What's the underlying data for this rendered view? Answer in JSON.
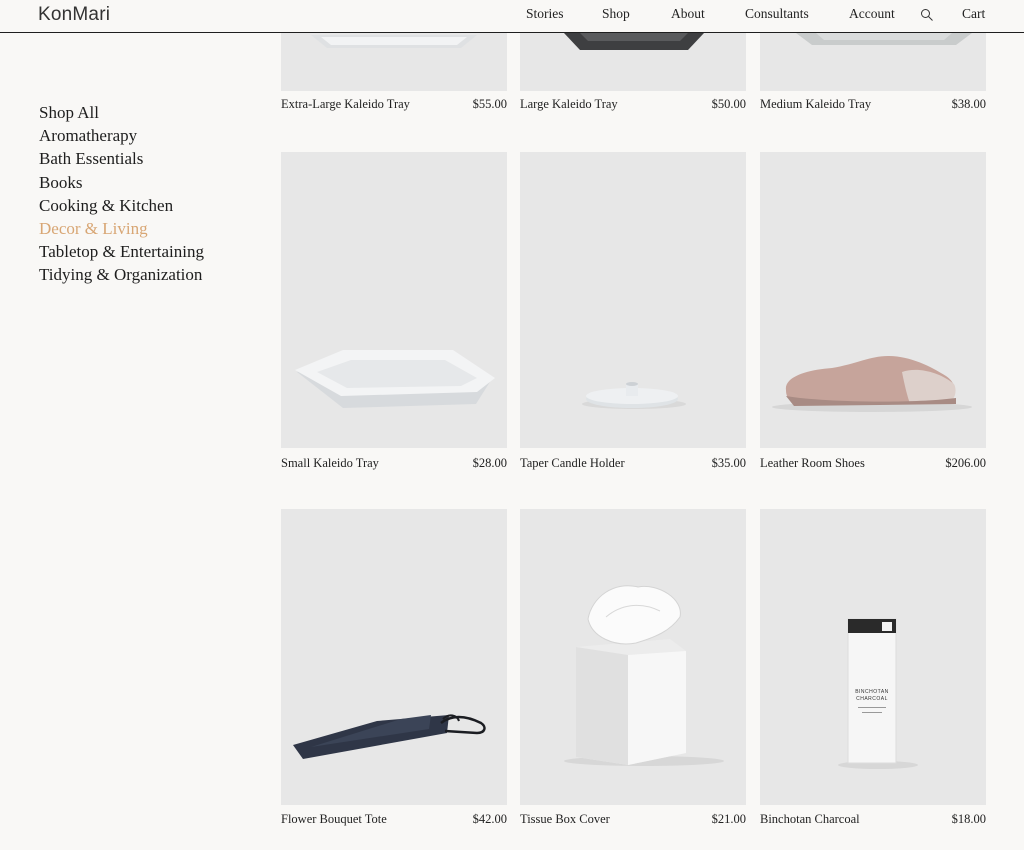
{
  "brand": {
    "logo": "KonMari"
  },
  "nav": {
    "items": [
      "Stories",
      "Shop",
      "About",
      "Consultants",
      "Account"
    ],
    "cart": "Cart"
  },
  "sidebar": {
    "items": [
      {
        "label": "Shop All"
      },
      {
        "label": "Aromatherapy"
      },
      {
        "label": "Bath Essentials"
      },
      {
        "label": "Books"
      },
      {
        "label": "Cooking & Kitchen"
      },
      {
        "label": "Decor & Living",
        "active": true
      },
      {
        "label": "Tabletop & Entertaining"
      },
      {
        "label": "Tidying & Organization"
      }
    ]
  },
  "products": [
    {
      "name": "Extra-Large Kaleido Tray",
      "price": "$55.00"
    },
    {
      "name": "Large Kaleido Tray",
      "price": "$50.00"
    },
    {
      "name": "Medium Kaleido Tray",
      "price": "$38.00"
    },
    {
      "name": "Small Kaleido Tray",
      "price": "$28.00"
    },
    {
      "name": "Taper Candle Holder",
      "price": "$35.00"
    },
    {
      "name": "Leather Room Shoes",
      "price": "$206.00"
    },
    {
      "name": "Flower Bouquet Tote",
      "price": "$42.00"
    },
    {
      "name": "Tissue Box Cover",
      "price": "$21.00"
    },
    {
      "name": "Binchotan Charcoal",
      "price": "$18.00"
    }
  ],
  "packaging": {
    "line1": "BINCHOTAN",
    "line2": "CHARCOAL"
  },
  "colors": {
    "accent": "#d8a674",
    "background": "#f9f8f6",
    "thumb": "#e7e7e7"
  }
}
